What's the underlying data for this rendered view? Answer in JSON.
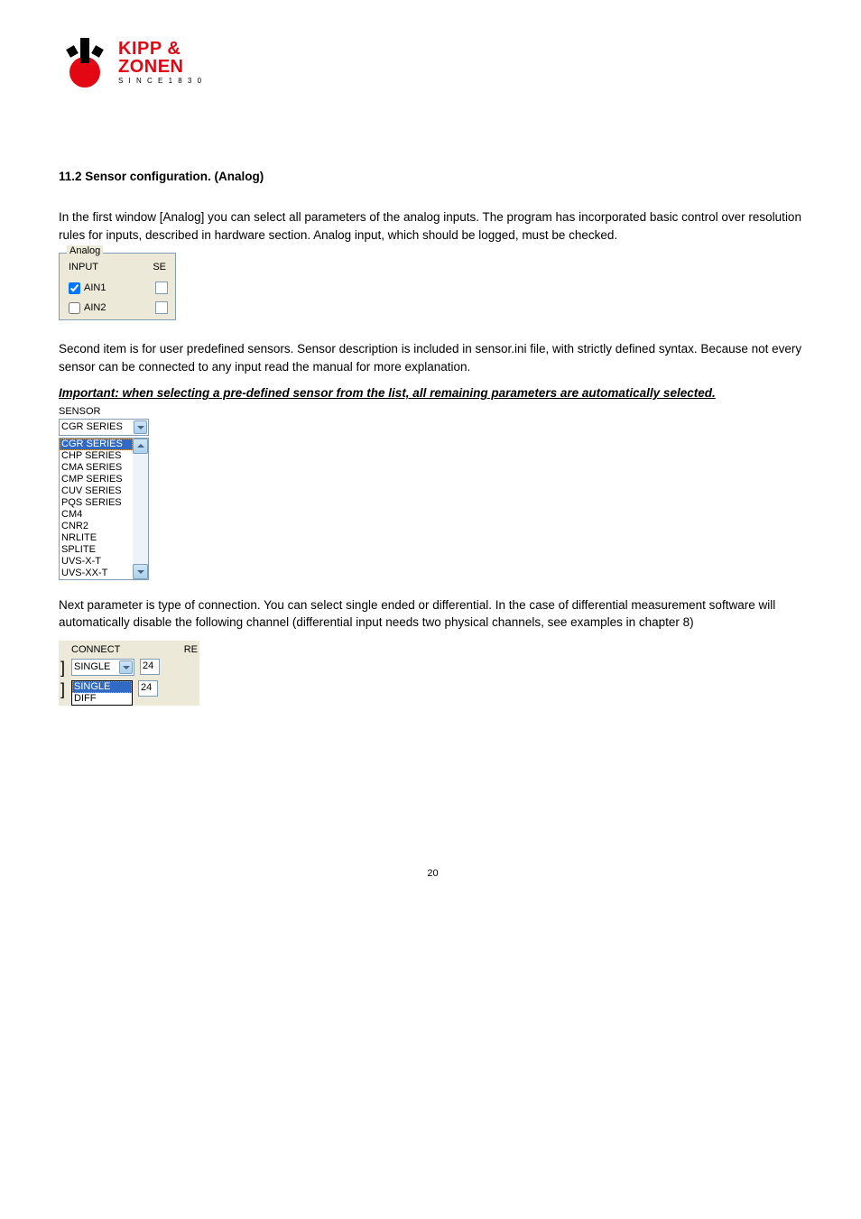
{
  "logo": {
    "line1": "KIPP &",
    "line2": "ZONEN",
    "line3": "S I N C E 1 8 3 0"
  },
  "heading": "11.2   Sensor configuration. (Analog)",
  "para1": "In the first window [Analog] you can select all parameters of the analog inputs. The program has incorporated basic control over resolution rules for inputs, described in hardware section.  Analog input, which should be logged, must be checked.",
  "analog": {
    "legend": "Analog",
    "col_input": "INPUT",
    "col_se": "SE",
    "row1": "AIN1",
    "row1_checked": true,
    "row2": "AIN2",
    "row2_checked": false
  },
  "para2": "Second item is for user predefined sensors. Sensor description is included in sensor.ini file, with strictly defined syntax. Because not every sensor can be connected to any input read the manual for more explanation.",
  "important": "Important: when selecting a pre-defined sensor from the list, all remaining parameters are automatically selected.",
  "sensor": {
    "label": "SENSOR",
    "selected": "CGR SERIES",
    "options": [
      "CGR SERIES",
      "CHP SERIES",
      "CMA SERIES",
      "CMP SERIES",
      "CUV SERIES",
      "PQS SERIES",
      "CM4",
      "CNR2",
      "NRLITE",
      "SPLITE",
      "UVS-X-T",
      "UVS-XX-T"
    ]
  },
  "para3": "Next parameter is type of connection. You can select single ended or differential. In the case of differential measurement software will automatically disable the following channel (differential input needs two physical channels, see examples in chapter 8)",
  "connect": {
    "col_connect": "CONNECT",
    "col_re": "RE",
    "row1_value": "SINGLE",
    "options": [
      "SINGLE",
      "DIFF"
    ],
    "re1": "24",
    "re2": "24"
  },
  "page_number": "20"
}
